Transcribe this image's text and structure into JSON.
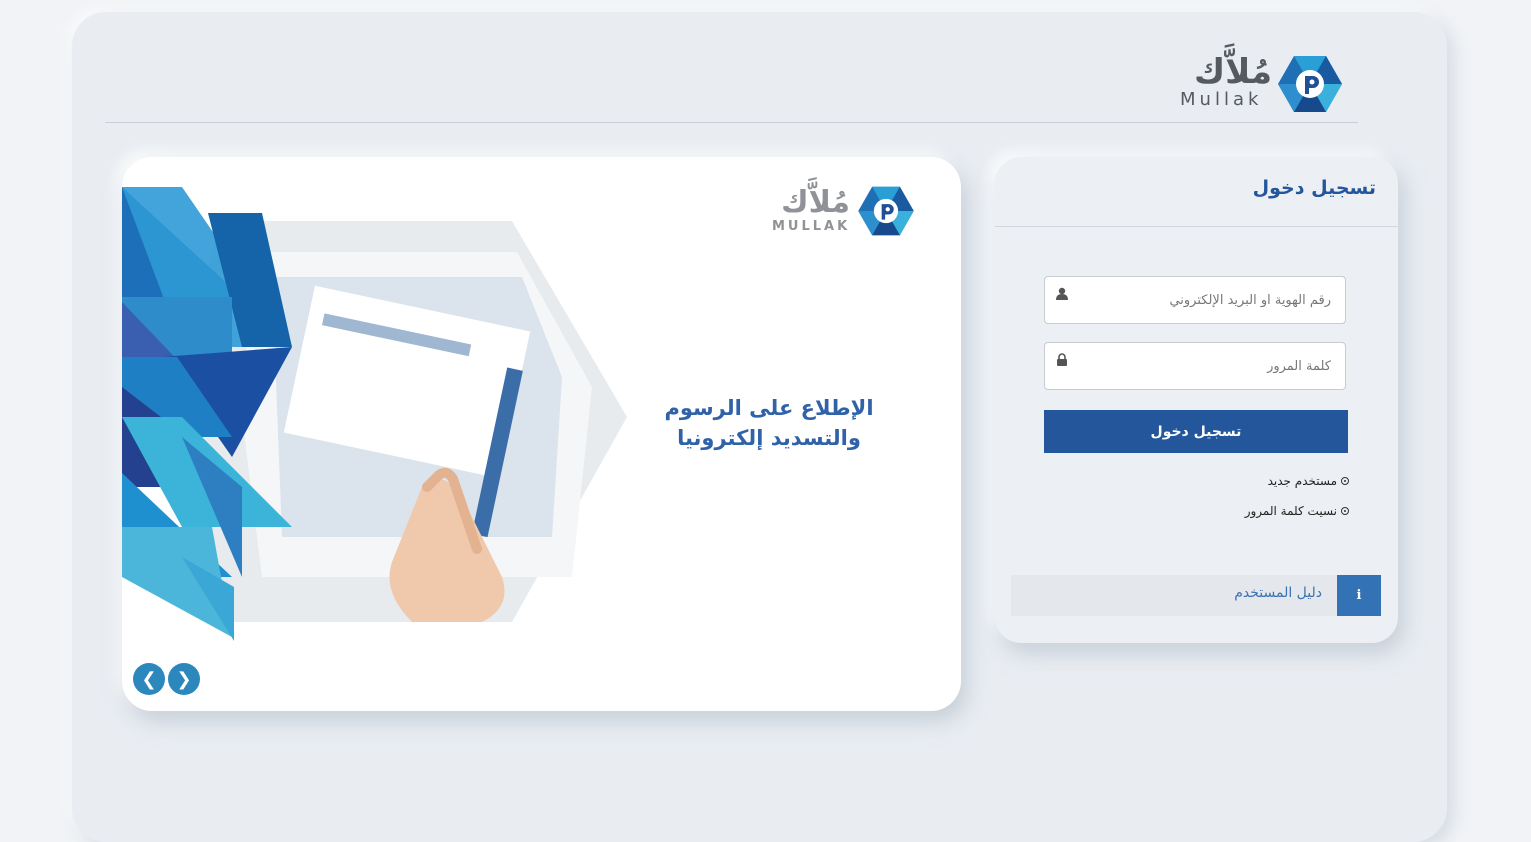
{
  "header": {
    "logo_ar": "مُلاَّك",
    "logo_en": "Mullak"
  },
  "slider": {
    "logo_ar": "مُلاَّك",
    "logo_en": "MULLAK",
    "headline_line1": "الإطلاع على الرسوم",
    "headline_line2": "والتسديد إلكترونيا",
    "prev_icon": "chevron-left-icon",
    "next_icon": "chevron-right-icon"
  },
  "login": {
    "title": "تسجيل دخول",
    "username_placeholder": "رقم الهوية او البريد الإلكتروني",
    "username_value": "",
    "password_placeholder": "كلمة المرور",
    "password_value": "",
    "submit_label": "تسجيل دخول",
    "new_user_label": "مستخدم جديد",
    "forgot_password_label": "نسيت كلمة المرور",
    "user_guide_label": "دليل المستخدم",
    "user_guide_icon_glyph": "i"
  },
  "colors": {
    "brand_blue": "#24569c",
    "accent_blue": "#3373b5",
    "slider_arrow": "#2b87bc",
    "panel_bg": "#e9edf2"
  }
}
